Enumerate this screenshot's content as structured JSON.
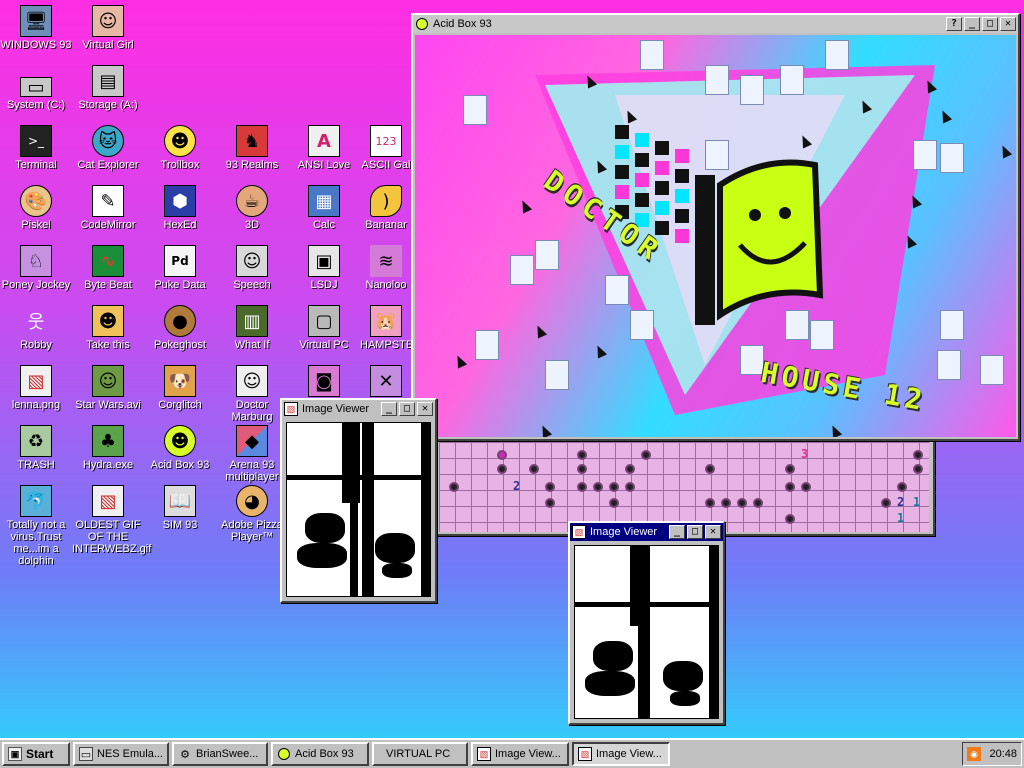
{
  "desktop": {
    "icons": [
      {
        "label": "WINDOWS 93",
        "icon": "computer-icon",
        "color": "#6f8fb8"
      },
      {
        "label": "Virtual Girl",
        "icon": "face-icon",
        "color": "#e7b8a3"
      },
      {
        "label": "System (C:)",
        "icon": "drive-icon",
        "color": "#c8c8c8"
      },
      {
        "label": "Storage (A:)",
        "icon": "floppy-drive-icon",
        "color": "#c8c8c8"
      },
      {
        "label": "Terminal",
        "icon": "terminal-icon",
        "color": "#222222"
      },
      {
        "label": "Cat Explorer",
        "icon": "cat-globe-icon",
        "color": "#3ea6c6"
      },
      {
        "label": "Trollbox",
        "icon": "chat-bubble-icon",
        "color": "#ffe24a"
      },
      {
        "label": "93 Realms",
        "icon": "knight-icon",
        "color": "#d83a3a"
      },
      {
        "label": "ANSI Love",
        "icon": "letter-a-icon",
        "color": "#f0f0f0"
      },
      {
        "label": "ASCII Gal",
        "icon": "ascii-icon",
        "color": "#ffffff"
      },
      {
        "label": "Piskel",
        "icon": "palette-icon",
        "color": "#e9c58b"
      },
      {
        "label": "CodeMirror",
        "icon": "code-cat-icon",
        "color": "#ffffff"
      },
      {
        "label": "HexEd",
        "icon": "cube-icon",
        "color": "#2b3ea6"
      },
      {
        "label": "3D",
        "icon": "teapot-icon",
        "color": "#e3a77c"
      },
      {
        "label": "Calc",
        "icon": "calculator-icon",
        "color": "#4a78c9"
      },
      {
        "label": "Bananar",
        "icon": "banana-icon",
        "color": "#f2c53d"
      },
      {
        "label": "Poney Jockey",
        "icon": "pony-icon",
        "color": "#c691e0"
      },
      {
        "label": "Byte Beat",
        "icon": "waveform-icon",
        "color": "#1b8e3a"
      },
      {
        "label": "Puke Data",
        "icon": "data-icon",
        "color": "#f5f5f5"
      },
      {
        "label": "Speech",
        "icon": "speech-face-icon",
        "color": "#d8d8d8"
      },
      {
        "label": "LSDJ",
        "icon": "gameboy-icon",
        "color": "#e6e6e6"
      },
      {
        "label": "Nanoloo",
        "icon": "wave-icon",
        "color": "#d37bd6"
      },
      {
        "label": "Robby",
        "icon": "stick-figure-icon",
        "color": "#ffffff"
      },
      {
        "label": "Take this",
        "icon": "character-icon",
        "color": "#f0c05a"
      },
      {
        "label": "Pokeghost",
        "icon": "cookie-icon",
        "color": "#b07a3a"
      },
      {
        "label": "What If",
        "icon": "film-icon",
        "color": "#4b6a2a"
      },
      {
        "label": "Virtual PC",
        "icon": "window-icon",
        "color": "#b9b9b9"
      },
      {
        "label": "HAMPSTER",
        "icon": "hamster-icon",
        "color": "#f0a0c0"
      },
      {
        "label": "lenna.png",
        "icon": "image-file-icon",
        "color": "#f0f0f0"
      },
      {
        "label": "Star Wars.avi",
        "icon": "yoda-icon",
        "color": "#6f9a45"
      },
      {
        "label": "Corglitch",
        "icon": "corgi-icon",
        "color": "#e0a24a"
      },
      {
        "label": "Doctor Marburg",
        "icon": "doctor-icon",
        "color": "#eeeeee"
      },
      {
        "label": "",
        "icon": "robot-icon",
        "color": "#d97ad2"
      },
      {
        "label": "",
        "icon": "crossed-icon",
        "color": "#c58de0"
      },
      {
        "label": "TRASH",
        "icon": "trash-icon",
        "color": "#a9c9a0"
      },
      {
        "label": "Hydra.exe",
        "icon": "hydra-icon",
        "color": "#5aa34a"
      },
      {
        "label": "Acid Box 93",
        "icon": "smiley-icon",
        "color": "#d9ff2a"
      },
      {
        "label": "Arena 93 multiplayer",
        "icon": "arena-cube-icon",
        "color": "#e05a7a"
      },
      {
        "label": "Totally not a virus.Trust me...im a dolphin",
        "icon": "dolphin-icon",
        "color": "#5ab0d8"
      },
      {
        "label": "OLDEST GIF OF THE INTERWEBZ.gif",
        "icon": "gif-file-icon",
        "color": "#f0f0f0"
      },
      {
        "label": "SIM 93",
        "icon": "book-icon",
        "color": "#dddddd"
      },
      {
        "label": "Adobe Pizza Player™",
        "icon": "pizza-icon",
        "color": "#e8b46a"
      }
    ]
  },
  "acid_box": {
    "title": "Acid Box 93",
    "art_text_1": "DOCTOR",
    "art_text_2": "HOUSE 12"
  },
  "minesweeper": {
    "numbers": [
      {
        "n": "3",
        "color": "#e02a8a"
      },
      {
        "n": "2",
        "color": "#333399"
      },
      {
        "n": "2",
        "color": "#333399"
      },
      {
        "n": "1",
        "color": "#1a7a9a"
      },
      {
        "n": "1",
        "color": "#1a7a9a"
      }
    ]
  },
  "image_viewer_1": {
    "title": "Image Viewer"
  },
  "image_viewer_2": {
    "title": "Image Viewer"
  },
  "title_buttons": {
    "help": "?",
    "minimize": "_",
    "maximize": "□",
    "close": "✕"
  },
  "taskbar": {
    "start": "Start",
    "buttons": [
      {
        "label": "NES Emula...",
        "icon": "nes-icon"
      },
      {
        "label": "BrianSwee...",
        "icon": "gear-icon"
      },
      {
        "label": "Acid Box 93",
        "icon": "smiley-icon"
      },
      {
        "label": "VIRTUAL PC",
        "icon": ""
      },
      {
        "label": "Image View...",
        "icon": "image-file-icon"
      },
      {
        "label": "Image View...",
        "icon": "image-file-icon"
      }
    ],
    "clock": "20:48"
  }
}
